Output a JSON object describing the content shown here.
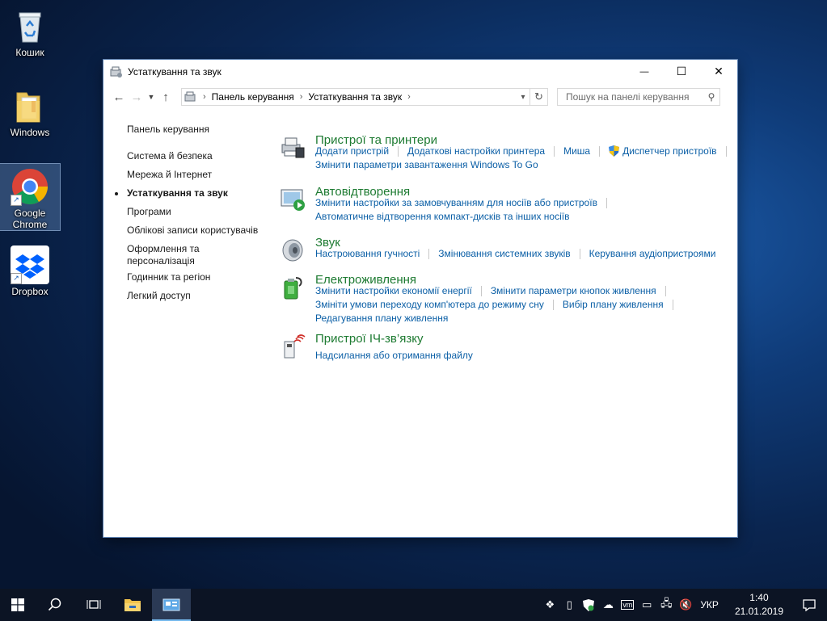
{
  "desktop": {
    "icons": [
      {
        "label": "Кошик"
      },
      {
        "label": "Windows"
      },
      {
        "label": "Google Chrome"
      },
      {
        "label": "Dropbox"
      }
    ]
  },
  "window": {
    "title": "Устаткування та звук",
    "controls": {
      "minimize": "—",
      "maximize": "☐",
      "close": "✕"
    },
    "breadcrumb": [
      "Панель керування",
      "Устаткування та звук"
    ],
    "search_placeholder": "Пошук на панелі керування"
  },
  "leftnav": {
    "items": [
      {
        "label": "Панель керування",
        "current": false
      },
      {
        "label": "Система й безпека",
        "current": false
      },
      {
        "label": "Мережа й Інтернет",
        "current": false
      },
      {
        "label": "Устаткування та звук",
        "current": true
      },
      {
        "label": "Програми",
        "current": false
      },
      {
        "label": "Облікові записи користувачів",
        "current": false
      },
      {
        "label": "Оформлення та",
        "current": false
      },
      {
        "label": "персоналізація",
        "current": false
      },
      {
        "label": "Годинник та регіон",
        "current": false
      },
      {
        "label": "Легкий доступ",
        "current": false
      }
    ]
  },
  "categories": [
    {
      "title": "Пристрої та принтери",
      "icon": "devices-printers-icon",
      "lines": [
        [
          "Додати пристрій",
          "Додаткові настройки принтера",
          "Миша",
          "Диспетчер пристроїв"
        ],
        [
          "Змінити параметри завантаження Windows To Go"
        ]
      ]
    },
    {
      "title": "Автовідтворення",
      "icon": "autoplay-icon",
      "lines": [
        [
          "Змінити настройки за замовчуванням для носіїв або пристроїв"
        ],
        [
          "Автоматичне відтворення компакт-дисків та інших носіїв"
        ]
      ]
    },
    {
      "title": "Звук",
      "icon": "speaker-icon",
      "lines": [
        [
          "Настроювання гучності",
          "Змінювання системних звуків",
          "Керування аудіопристроями"
        ]
      ]
    },
    {
      "title": "Електроживлення",
      "icon": "battery-power-icon",
      "lines": [
        [
          "Змінити настройки економії енергії",
          "Змінити параметри кнопок живлення"
        ],
        [
          "Змініти умови переходу комп'ютера до режиму сну",
          "Вибір плану живлення"
        ],
        [
          "Редагування плану живлення"
        ]
      ]
    },
    {
      "title": "Пристрої ІЧ-зв’язку",
      "icon": "infrared-icon",
      "lines": [
        [
          "Надсилання або отримання файлу"
        ]
      ]
    }
  ],
  "taskbar": {
    "language": "УКР",
    "time": "1:40",
    "date": "21.01.2019"
  }
}
